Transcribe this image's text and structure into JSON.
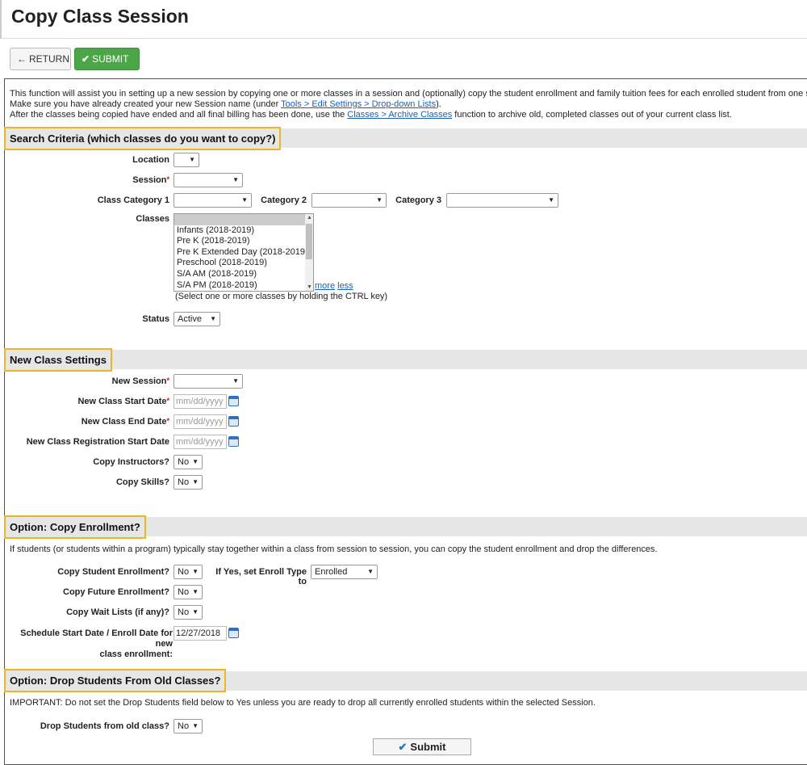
{
  "page_title": "Copy Class Session",
  "toolbar": {
    "return_label": "RETURN",
    "submit_label": "SUBMIT"
  },
  "intro": {
    "line1": "This function will assist you in setting up a new session by copying one or more classes in a session and (optionally) copy the student enrollment and family tuition fees for each enrolled student from one session to a",
    "line2_pre": "Make sure you have already created your new Session name (under ",
    "line2_link": "Tools > Edit Settings > Drop-down Lists",
    "line2_post": ").",
    "line3_pre": "After the classes being copied have ended and all final billing has been done, use the ",
    "line3_link": "Classes > Archive Classes",
    "line3_post": " function to archive old, completed classes out of your current class list."
  },
  "search": {
    "title": "Search Criteria (which classes do you want to copy?)",
    "location_label": "Location",
    "session_label": "Session",
    "class_category_1_label": "Class Category 1",
    "category_2_label": "Category 2",
    "category_3_label": "Category 3",
    "classes_label": "Classes",
    "classes": [
      "",
      "Infants (2018-2019)",
      "Pre K (2018-2019)",
      "Pre K Extended Day (2018-2019)",
      "Preschool (2018-2019)",
      "S/A AM (2018-2019)",
      "S/A PM (2018-2019)"
    ],
    "more_link": "more",
    "less_link": "less",
    "hint": "(Select one or more classes by holding the CTRL key)",
    "status_label": "Status",
    "status_value": "Active"
  },
  "new_class": {
    "title": "New Class Settings",
    "new_session_label": "New Session",
    "start_date_label": "New Class Start Date",
    "end_date_label": "New Class End Date",
    "reg_start_label": "New Class Registration Start Date",
    "date_placeholder": "mm/dd/yyyy",
    "copy_instructors_label": "Copy Instructors?",
    "copy_instructors_value": "No",
    "copy_skills_label": "Copy Skills?",
    "copy_skills_value": "No"
  },
  "enrollment": {
    "title": "Option: Copy Enrollment?",
    "description": "If students (or students within a program) typically stay together within a class from session to session, you can copy the student enrollment and drop the differences.",
    "copy_student_label": "Copy Student Enrollment?",
    "copy_student_value": "No",
    "enroll_type_label": "If Yes, set Enroll Type to",
    "enroll_type_value": "Enrolled",
    "copy_future_label": "Copy Future Enrollment?",
    "copy_future_value": "No",
    "copy_wait_label": "Copy Wait Lists (if any)?",
    "copy_wait_value": "No",
    "schedule_label_1": "Schedule Start Date / Enroll Date for new",
    "schedule_label_2": "class enrollment:",
    "schedule_value": "12/27/2018"
  },
  "drop": {
    "title": "Option: Drop Students From Old Classes?",
    "important": "IMPORTANT: Do not set the Drop Students field below to Yes unless you are ready to drop all currently enrolled students within the selected Session.",
    "drop_label": "Drop Students from old class?",
    "drop_value": "No"
  },
  "bottom_submit": "Submit",
  "icons": {
    "return": "arrow-left-icon",
    "check": "check-icon",
    "calendar": "calendar-icon",
    "dropdown": "chevron-down-icon"
  },
  "colors": {
    "submit_green": "#4aa646",
    "highlight": "#f0b429",
    "link": "#1a5fb4",
    "required": "#dd0000"
  }
}
